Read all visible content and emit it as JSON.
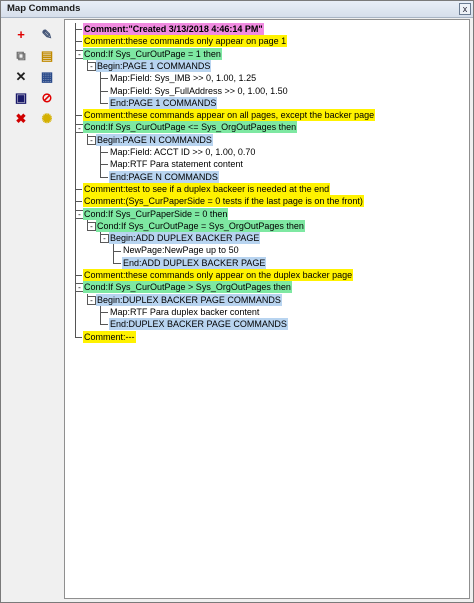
{
  "window": {
    "title": "Map Commands",
    "close_label": "x"
  },
  "toolbar": {
    "buttons": [
      {
        "name": "add-icon",
        "glyph": "+",
        "color": "#e00000"
      },
      {
        "name": "edit-properties-icon",
        "glyph": "✎",
        "color": "#445577"
      },
      {
        "name": "copy-icon",
        "glyph": "⧉",
        "color": "#6a6a6a"
      },
      {
        "name": "open-folder-icon",
        "glyph": "▤",
        "color": "#c08a00"
      },
      {
        "name": "delete-icon",
        "glyph": "✕",
        "color": "#202020"
      },
      {
        "name": "properties-list-icon",
        "glyph": "▦",
        "color": "#2a4a8a"
      },
      {
        "name": "save-icon",
        "glyph": "▣",
        "color": "#1a1a6a"
      },
      {
        "name": "disable-icon",
        "glyph": "⊘",
        "color": "#e00000"
      },
      {
        "name": "remove-icon",
        "glyph": "✖",
        "color": "#d00000"
      },
      {
        "name": "lightbulb-icon",
        "glyph": "✺",
        "color": "#d4b000"
      }
    ]
  },
  "tree": {
    "nodes": [
      {
        "text": "Comment:\"Created 3/13/2018 4:46:14 PM\"",
        "style": "pink",
        "level": 0,
        "toggle": ""
      },
      {
        "text": "Comment:these commands only appear on page 1",
        "style": "yellow",
        "level": 0,
        "toggle": ""
      },
      {
        "text": "Cond:If Sys_CurOutPage = 1 then",
        "style": "green",
        "level": 0,
        "toggle": "-"
      },
      {
        "text": "Begin:PAGE 1 COMMANDS",
        "style": "blue",
        "level": 1,
        "toggle": "-"
      },
      {
        "text": "Map:Field: Sys_IMB >>      0, 1.00, 1.25",
        "style": "none",
        "level": 2,
        "toggle": ""
      },
      {
        "text": "Map:Field: Sys_FullAddress >>      0, 1.00, 1.50",
        "style": "none",
        "level": 2,
        "toggle": ""
      },
      {
        "text": "End:PAGE 1 COMMANDS",
        "style": "blue",
        "level": 2,
        "toggle": ""
      },
      {
        "text": "Comment:these commands appear on all pages, except the backer page",
        "style": "yellow",
        "level": 0,
        "toggle": ""
      },
      {
        "text": "Cond:If Sys_CurOutPage <= Sys_OrgOutPages then",
        "style": "green",
        "level": 0,
        "toggle": "-"
      },
      {
        "text": "Begin:PAGE N COMMANDS",
        "style": "blue",
        "level": 1,
        "toggle": "-"
      },
      {
        "text": "Map:Field: ACCT ID >>      0, 1.00, 0.70",
        "style": "none",
        "level": 2,
        "toggle": ""
      },
      {
        "text": "Map:RTF Para statement content",
        "style": "none",
        "level": 2,
        "toggle": ""
      },
      {
        "text": "End:PAGE N COMMANDS",
        "style": "blue",
        "level": 2,
        "toggle": ""
      },
      {
        "text": "Comment:test to see if a duplex backeer is needed at the end",
        "style": "yellow",
        "level": 0,
        "toggle": ""
      },
      {
        "text": "Comment:(Sys_CurPaperSide = 0 tests if the last page is on the front)",
        "style": "yellow",
        "level": 0,
        "toggle": ""
      },
      {
        "text": "Cond:If Sys_CurPaperSide = 0 then",
        "style": "green",
        "level": 0,
        "toggle": "-"
      },
      {
        "text": "Cond:If Sys_CurOutPage = Sys_OrgOutPages then",
        "style": "green",
        "level": 1,
        "toggle": "-"
      },
      {
        "text": "Begin:ADD DUPLEX BACKER PAGE",
        "style": "blue",
        "level": 2,
        "toggle": "-"
      },
      {
        "text": "NewPage:NewPage up to 50",
        "style": "none",
        "level": 3,
        "toggle": ""
      },
      {
        "text": "End:ADD DUPLEX BACKER PAGE",
        "style": "blue",
        "level": 3,
        "toggle": ""
      },
      {
        "text": "Comment:these commands only appear on the duplex backer page",
        "style": "yellow",
        "level": 0,
        "toggle": ""
      },
      {
        "text": "Cond:If Sys_CurOutPage > Sys_OrgOutPages then",
        "style": "green",
        "level": 0,
        "toggle": "-"
      },
      {
        "text": "Begin:DUPLEX BACKER PAGE COMMANDS",
        "style": "blue",
        "level": 1,
        "toggle": "-"
      },
      {
        "text": "Map:RTF Para duplex backer content",
        "style": "none",
        "level": 2,
        "toggle": ""
      },
      {
        "text": "End:DUPLEX BACKER PAGE COMMANDS",
        "style": "blue",
        "level": 2,
        "toggle": ""
      },
      {
        "text": "Comment:---",
        "style": "yellow",
        "level": 0,
        "toggle": ""
      }
    ]
  }
}
